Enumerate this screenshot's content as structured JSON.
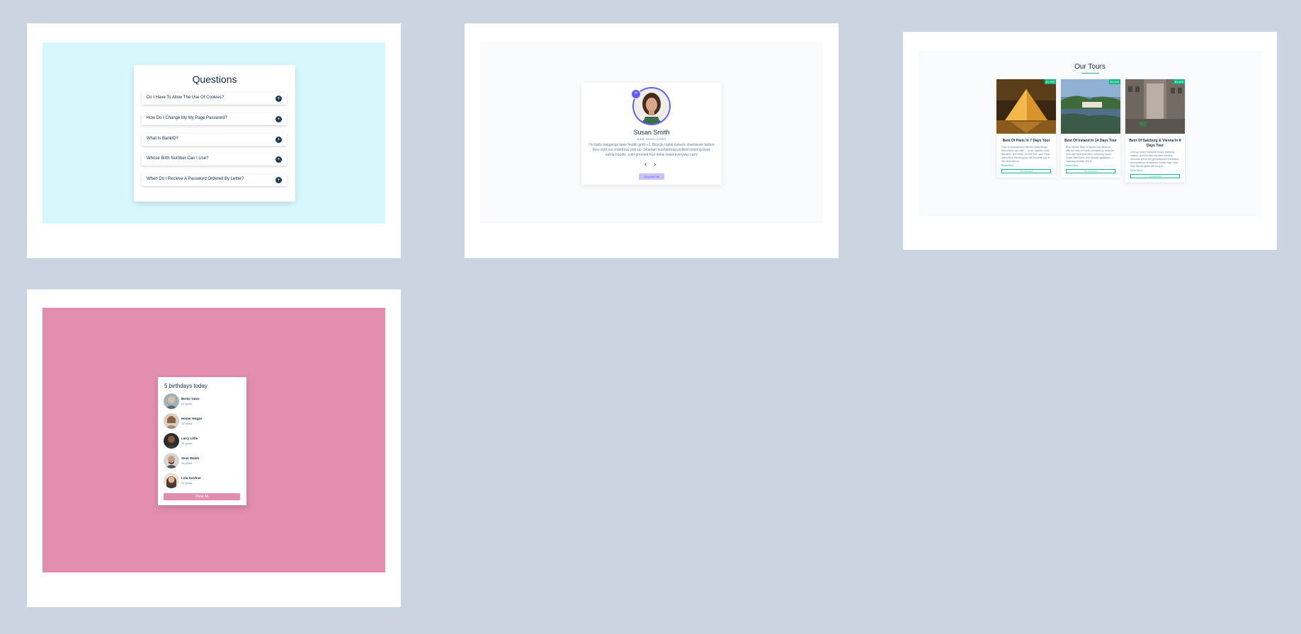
{
  "questions": {
    "title": "Questions",
    "toggle_symbol": "+",
    "items": [
      {
        "question": "Do I Have To Allow The Use Of Cookies?"
      },
      {
        "question": "How Do I Change My My Page Password?"
      },
      {
        "question": "What Is BankID?"
      },
      {
        "question": "Whose Birth Number Can I Use?"
      },
      {
        "question": "When Do I Recieve A Password Ordered By Letter?"
      }
    ]
  },
  "review": {
    "quote_icon": "”",
    "name": "Susan Smith",
    "job": "WEB DEVELOPER",
    "text": "I'm baby meggings twee health goth +1. Bicycle rights tumeric chartreuse before they sold out chambray pop-up. Shaman humblebrag pickled coloring book salvia hoodie, cold-pressed four dollar toast everyday carry",
    "prev_label": "‹",
    "next_label": "›",
    "random_label": "Surprise Me"
  },
  "tours": {
    "title": "Our Tours",
    "items": [
      {
        "name": "Best Of Paris In 7 Days Tour",
        "price": "$1,995",
        "info": "Paris is synonymous with the finest things that culture can offer — in art, fashion, food, literature, and ideas. On this tour, your Paris-savvy Rick Steves guide will immerse you in the very best of ...",
        "more": "Read More",
        "button": "Not Interested"
      },
      {
        "name": "Best Of Ireland In 14 Days Tour",
        "price": "$3,895",
        "info": "Rick Steves' Best of Ireland tour kicks off with the best of Dublin, followed by Ireland's must-see historical sites, charming towns, music-filled pubs, and seaside getaways — including Kinsale, the D...",
        "more": "Read More",
        "button": "Not Interested"
      },
      {
        "name": "Best Of Salzburg & Vienna In 8 Days Tour",
        "price": "$2,695",
        "info": "Let's go where classical music, towering castles, and the-hills-are-alive scenery welcome you to the gemütlichkeit of Bavaria and opulence of Austria's Golden Age. Your Rick Steves guide will bring th...",
        "more": "Read More",
        "button": "Not Interested"
      }
    ]
  },
  "birthdays": {
    "title": "5 birthdays today",
    "people": [
      {
        "name": "Bertie Yates",
        "age": "29 years"
      },
      {
        "name": "Hester Hogan",
        "age": "32 years"
      },
      {
        "name": "Larry Little",
        "age": "36 years"
      },
      {
        "name": "Sean Walsh",
        "age": "34 years"
      },
      {
        "name": "Lola Gardner",
        "age": "29 years"
      }
    ],
    "clear_label": "Clear All"
  }
}
